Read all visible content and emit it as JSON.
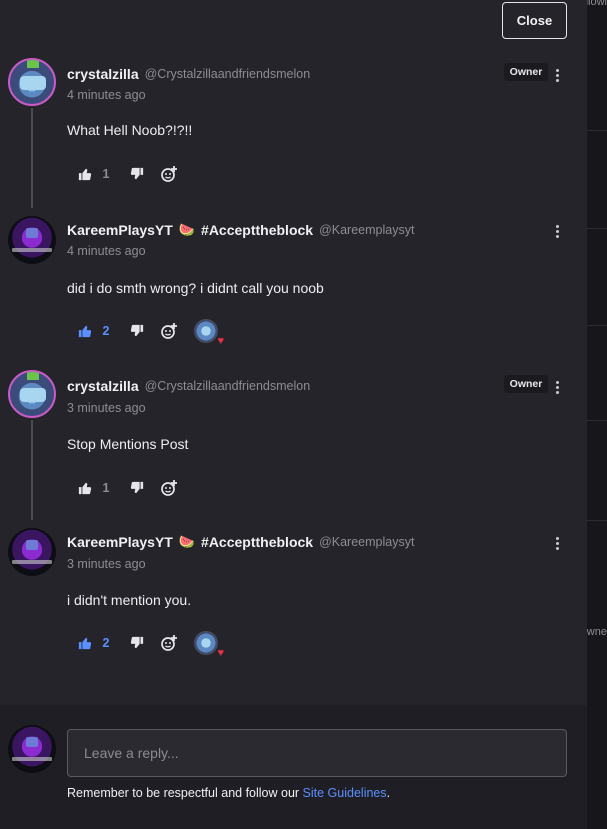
{
  "modal": {
    "close_label": "Close",
    "reply_placeholder": "Leave a reply...",
    "guidelines_prefix": "Remember to be respectful and follow our ",
    "guidelines_link": "Site Guidelines",
    "guidelines_suffix": "."
  },
  "background": {
    "top_right_text": "Followi",
    "right_text": "Owne"
  },
  "comments": [
    {
      "username": "crystalzilla",
      "handle": "@Crystalzillaandfriendsmelon",
      "time": "4 minutes ago",
      "body": "What Hell Noob?!?!!",
      "badge": "Owner",
      "likes": "1",
      "liked": false,
      "has_reaction": false
    },
    {
      "username": "KareemPlaysYT",
      "emoji": "🍉",
      "tag": "#Accepttheblock",
      "handle": "@Kareemplaysyt",
      "time": "4 minutes ago",
      "body": "did i do smth wrong? i didnt call you noob",
      "likes": "2",
      "liked": true,
      "has_reaction": true,
      "reaction": "heart"
    },
    {
      "username": "crystalzilla",
      "handle": "@Crystalzillaandfriendsmelon",
      "time": "3 minutes ago",
      "body": "Stop Mentions Post",
      "badge": "Owner",
      "likes": "1",
      "liked": false,
      "has_reaction": false
    },
    {
      "username": "KareemPlaysYT",
      "emoji": "🍉",
      "tag": "#Accepttheblock",
      "handle": "@Kareemplaysyt",
      "time": "3 minutes ago",
      "body": "i didn't mention you.",
      "likes": "2",
      "liked": true,
      "has_reaction": true,
      "reaction": "heart"
    }
  ],
  "colors": {
    "panel_bg": "#25242b",
    "liked_blue": "#5c8fff",
    "muted": "#8d8c94",
    "owner_ring": "#c95bc8",
    "heart": "#e8304a"
  },
  "icons": [
    "thumbs-up-icon",
    "thumbs-down-icon",
    "add-reaction-icon",
    "more-vertical-icon",
    "heart-icon"
  ]
}
